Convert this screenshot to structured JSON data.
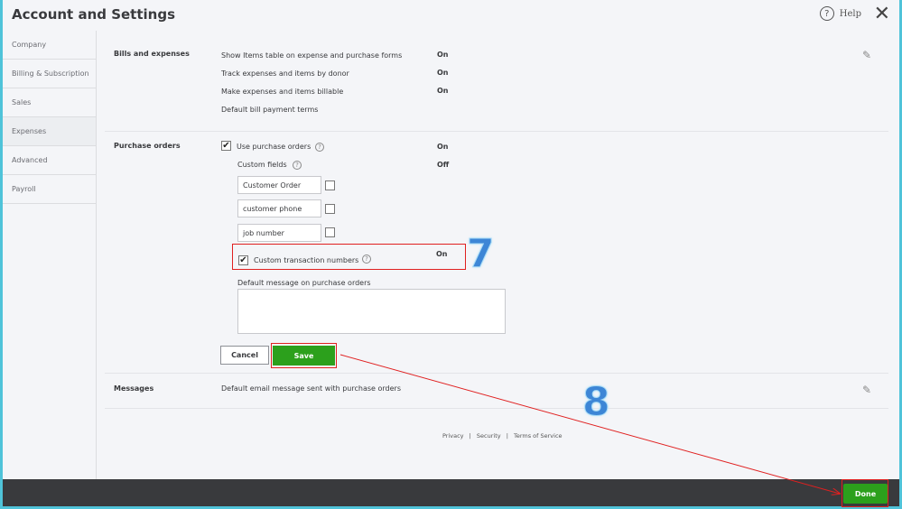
{
  "header": {
    "title": "Account and Settings",
    "help_label": "Help",
    "help_icon": "?",
    "close_icon": "✕"
  },
  "sidebar": {
    "items": [
      {
        "label": "Company"
      },
      {
        "label": "Billing & Subscription"
      },
      {
        "label": "Sales"
      },
      {
        "label": "Expenses",
        "active": true
      },
      {
        "label": "Advanced"
      },
      {
        "label": "Payroll"
      }
    ]
  },
  "bills": {
    "title": "Bills and expenses",
    "rows": [
      {
        "label": "Show Items table on expense and purchase forms",
        "value": "On"
      },
      {
        "label": "Track expenses and items by donor",
        "value": "On"
      },
      {
        "label": "Make expenses and items billable",
        "value": "On"
      },
      {
        "label": "Default bill payment terms",
        "value": ""
      }
    ]
  },
  "po": {
    "title": "Purchase orders",
    "use_label": "Use purchase orders",
    "use_value": "On",
    "custom_fields_label": "Custom fields",
    "custom_fields_value": "Off",
    "fields": [
      {
        "value": "Customer  Order"
      },
      {
        "value": "customer phone"
      },
      {
        "value": "job number"
      }
    ],
    "ctn_label": "Custom transaction numbers",
    "ctn_value": "On",
    "default_msg_label": "Default message on purchase orders",
    "default_msg_value": "",
    "cancel_label": "Cancel",
    "save_label": "Save"
  },
  "messages": {
    "title": "Messages",
    "row": "Default email message sent with purchase orders"
  },
  "footer": {
    "privacy": "Privacy",
    "security": "Security",
    "terms": "Terms of Service",
    "sep": "|"
  },
  "done_label": "Done",
  "annotations": {
    "step7": "7",
    "step8": "8"
  },
  "colors": {
    "accent_green": "#2ca01c",
    "annotation_red": "#e02020",
    "frame_cyan": "#4fc3d9"
  }
}
